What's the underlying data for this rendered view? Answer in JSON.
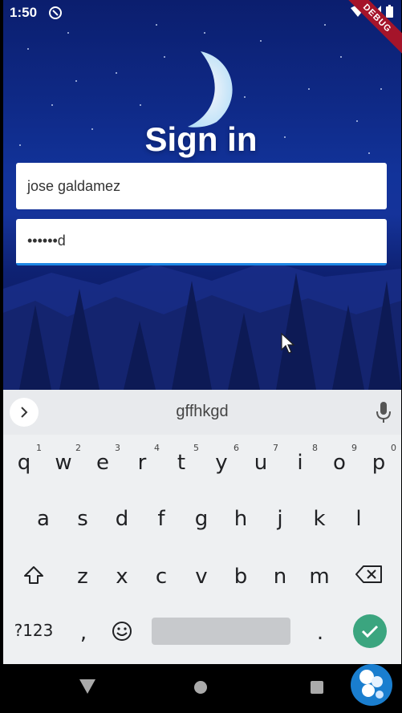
{
  "status_bar": {
    "time": "1:50",
    "debug_label": "DEBUG"
  },
  "login": {
    "title": "Sign in",
    "username_value": "jose galdamez",
    "password_value": "••••••d"
  },
  "keyboard": {
    "suggestion": "gffhkgd",
    "row1": [
      {
        "k": "q",
        "n": "1"
      },
      {
        "k": "w",
        "n": "2"
      },
      {
        "k": "e",
        "n": "3"
      },
      {
        "k": "r",
        "n": "4"
      },
      {
        "k": "t",
        "n": "5"
      },
      {
        "k": "y",
        "n": "6"
      },
      {
        "k": "u",
        "n": "7"
      },
      {
        "k": "i",
        "n": "8"
      },
      {
        "k": "o",
        "n": "9"
      },
      {
        "k": "p",
        "n": "0"
      }
    ],
    "row2": [
      "a",
      "s",
      "d",
      "f",
      "g",
      "h",
      "j",
      "k",
      "l"
    ],
    "row3": [
      "z",
      "x",
      "c",
      "v",
      "b",
      "n",
      "m"
    ],
    "symbols_label": "?123",
    "comma": ",",
    "period": "."
  },
  "colors": {
    "accent": "#1e88e5",
    "enter_key": "#3ba57f",
    "debug_banner": "#a5142a"
  }
}
